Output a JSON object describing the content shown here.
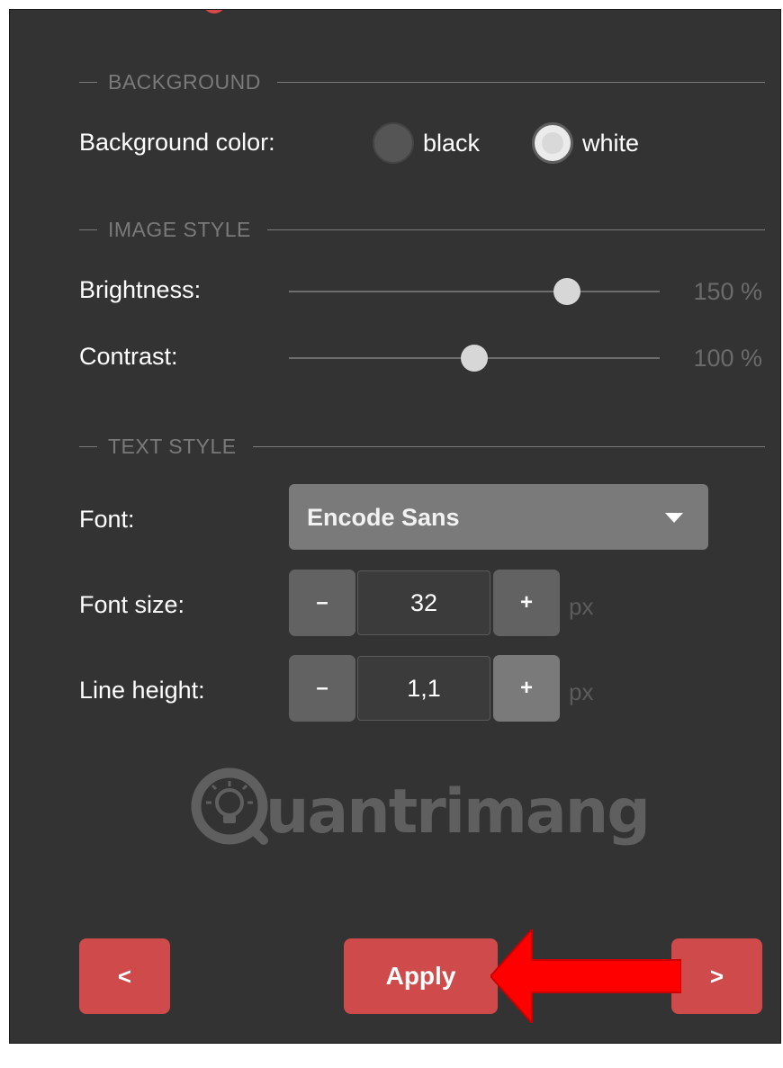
{
  "sections": {
    "background": "BACKGROUND",
    "image_style": "IMAGE STYLE",
    "text_style": "TEXT STYLE"
  },
  "background_color": {
    "label": "Background color:",
    "options": [
      "black",
      "white"
    ],
    "selected": "white"
  },
  "brightness": {
    "label": "Brightness:",
    "value": 150,
    "value_text": "150 %"
  },
  "contrast": {
    "label": "Contrast:",
    "value": 100,
    "value_text": "100 %"
  },
  "font": {
    "label": "Font:",
    "value": "Encode Sans"
  },
  "font_size": {
    "label": "Font size:",
    "value": "32",
    "unit": "px",
    "minus": "–",
    "plus": "+"
  },
  "line_height": {
    "label": "Line height:",
    "value": "1,1",
    "unit": "px",
    "minus": "–",
    "plus": "+"
  },
  "watermark": {
    "text": "uantrimang",
    "icon": "lightbulb-icon"
  },
  "buttons": {
    "prev": "<",
    "apply": "Apply",
    "next": ">"
  },
  "colors": {
    "panel_bg": "#333333",
    "accent": "#cf4a4a",
    "annotation_arrow": "#ff0000"
  }
}
